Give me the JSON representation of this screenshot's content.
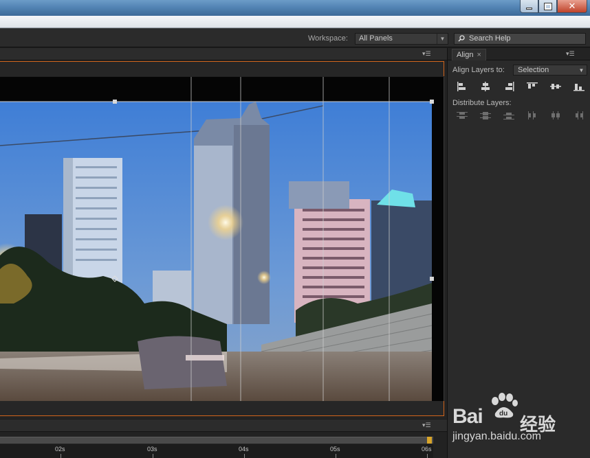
{
  "window": {
    "controls": [
      "minimize",
      "restore",
      "close"
    ]
  },
  "toolbar": {
    "workspace_label": "Workspace:",
    "workspace_value": "All Panels",
    "search_placeholder": "Search Help"
  },
  "timeline": {
    "ticks": [
      "02s",
      "03s",
      "04s",
      "05s",
      "06s"
    ]
  },
  "align_panel": {
    "tab_label": "Align",
    "tab_close": "×",
    "align_layers_label": "Align Layers to:",
    "align_layers_value": "Selection",
    "distribute_label": "Distribute Layers:",
    "align_icons": [
      "align-left-icon",
      "align-horizontal-center-icon",
      "align-right-icon",
      "align-top-icon",
      "align-vertical-center-icon",
      "align-bottom-icon"
    ],
    "distribute_icons": [
      "distribute-top-icon",
      "distribute-vertical-center-icon",
      "distribute-bottom-icon",
      "distribute-left-icon",
      "distribute-horizontal-center-icon",
      "distribute-right-icon"
    ]
  },
  "watermark": {
    "brand": "Bai",
    "chinese": "经验",
    "url": "jingyan.baidu.com"
  },
  "colors": {
    "accent_orange": "#d2651b",
    "panel_bg": "#2a2a2a",
    "timeline_end": "#d8a52a"
  }
}
